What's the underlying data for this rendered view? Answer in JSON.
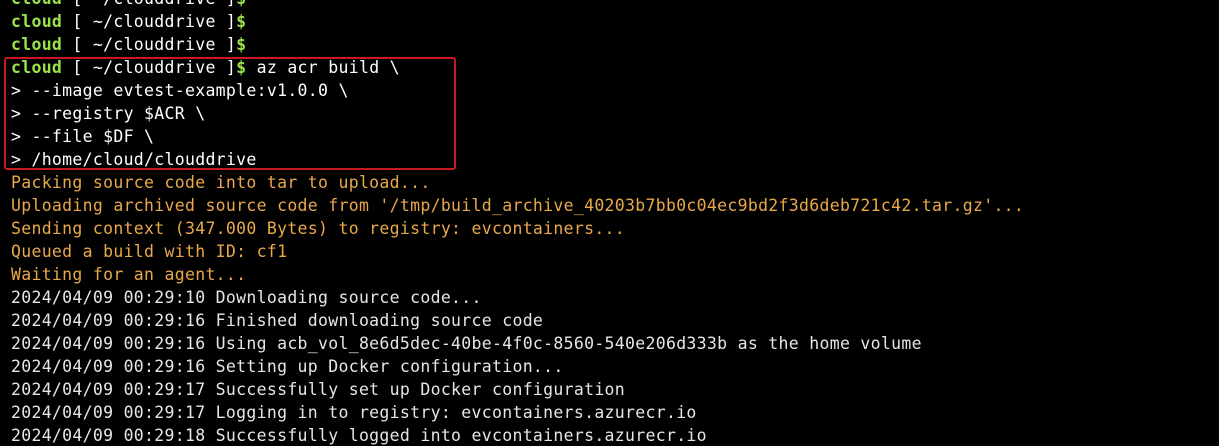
{
  "terminal": {
    "prompt_lines": [
      {
        "user": "cloud",
        "path": " [ ~/clouddrive ]",
        "symbol": "$",
        "command": ""
      },
      {
        "user": "cloud",
        "path": " [ ~/clouddrive ]",
        "symbol": "$",
        "command": ""
      },
      {
        "user": "cloud",
        "path": " [ ~/clouddrive ]",
        "symbol": "$",
        "command": ""
      },
      {
        "user": "cloud",
        "path": " [ ~/clouddrive ]",
        "symbol": "$",
        "command": " az acr build \\"
      }
    ],
    "continuation_lines": [
      "> --image evtest-example:v1.0.0 \\",
      "> --registry $ACR \\",
      "> --file $DF \\",
      "> /home/cloud/clouddrive"
    ],
    "orange_output": [
      "Packing source code into tar to upload...",
      "Uploading archived source code from '/tmp/build_archive_40203b7bb0c04ec9bd2f3d6deb721c42.tar.gz'...",
      "Sending context (347.000 Bytes) to registry: evcontainers...",
      "Queued a build with ID: cf1",
      "Waiting for an agent..."
    ],
    "log_output": [
      "2024/04/09 00:29:10 Downloading source code...",
      "2024/04/09 00:29:16 Finished downloading source code",
      "2024/04/09 00:29:16 Using acb_vol_8e6d5dec-40be-4f0c-8560-540e206d333b as the home volume",
      "2024/04/09 00:29:16 Setting up Docker configuration...",
      "2024/04/09 00:29:17 Successfully set up Docker configuration",
      "2024/04/09 00:29:17 Logging in to registry: evcontainers.azurecr.io",
      "2024/04/09 00:29:18 Successfully logged into evcontainers.azurecr.io"
    ]
  },
  "colors": {
    "background": "#000000",
    "prompt": "#9ae34a",
    "orange_output": "#e9a84a",
    "highlight_box": "#c8191e"
  }
}
